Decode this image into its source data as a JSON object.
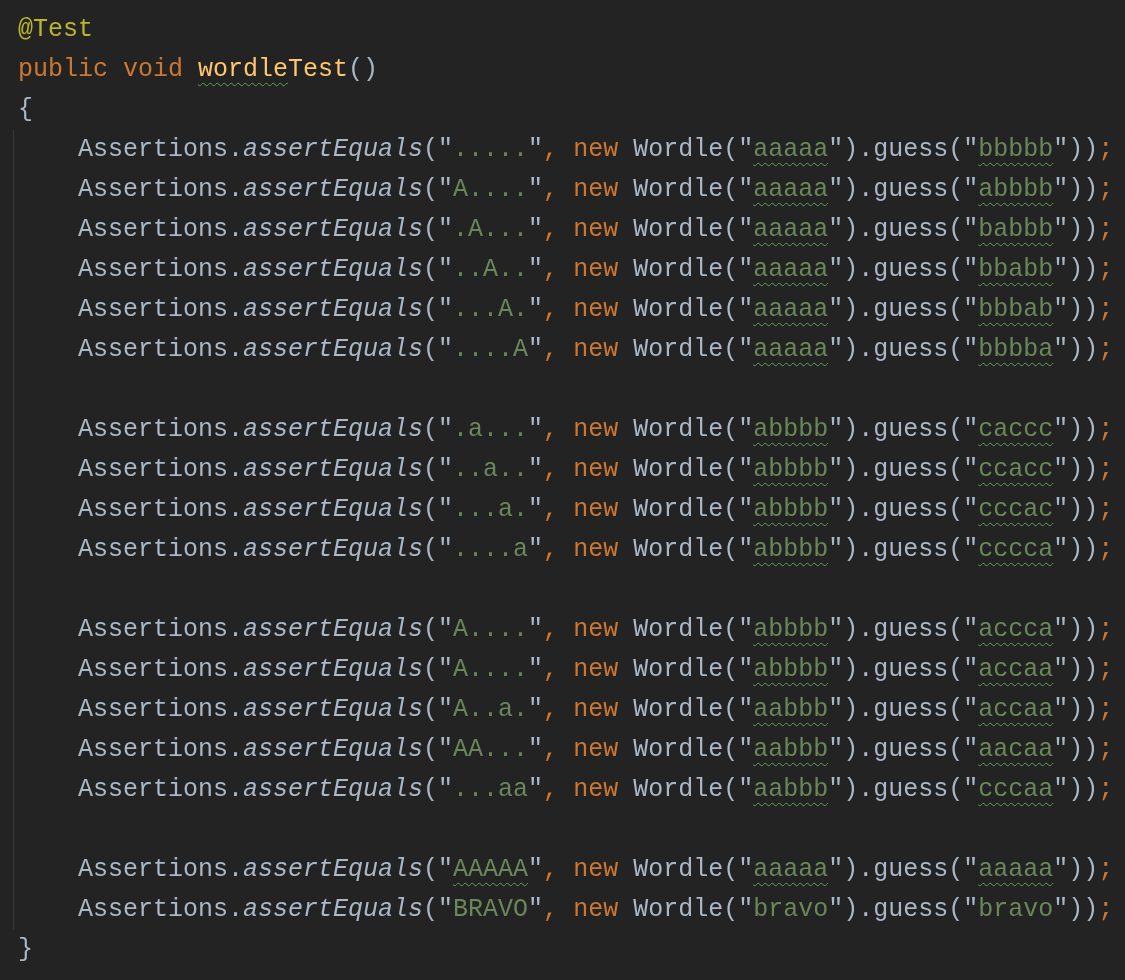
{
  "editor": {
    "lines": [
      {
        "kind": "code",
        "indented": false,
        "tokens": [
          {
            "kind": "annotation",
            "text": "@Test"
          }
        ]
      },
      {
        "kind": "code",
        "indented": false,
        "tokens": [
          {
            "kind": "keyword",
            "text": "public void "
          },
          {
            "kind": "method-decl",
            "text": "wordle",
            "typo": true
          },
          {
            "kind": "method-decl",
            "text": "Test",
            "typo": false
          },
          {
            "kind": "plain",
            "text": "()"
          }
        ]
      },
      {
        "kind": "code",
        "indented": false,
        "tokens": [
          {
            "kind": "plain",
            "text": "{"
          }
        ]
      },
      {
        "kind": "code",
        "indented": true,
        "tokens": [
          {
            "kind": "plain",
            "text": "Assertions."
          },
          {
            "kind": "static-call",
            "text": "assertEquals"
          },
          {
            "kind": "plain",
            "text": "(\""
          },
          {
            "kind": "string",
            "text": ".....",
            "typo": false
          },
          {
            "kind": "plain",
            "text": "\""
          },
          {
            "kind": "separator",
            "text": ", "
          },
          {
            "kind": "keyword",
            "text": "new "
          },
          {
            "kind": "plain",
            "text": "Wordle(\""
          },
          {
            "kind": "string",
            "text": "aaaaa",
            "typo": true
          },
          {
            "kind": "plain",
            "text": "\").guess(\""
          },
          {
            "kind": "string",
            "text": "bbbbb",
            "typo": true
          },
          {
            "kind": "plain",
            "text": "\"))"
          },
          {
            "kind": "separator",
            "text": ";"
          }
        ]
      },
      {
        "kind": "code",
        "indented": true,
        "tokens": [
          {
            "kind": "plain",
            "text": "Assertions."
          },
          {
            "kind": "static-call",
            "text": "assertEquals"
          },
          {
            "kind": "plain",
            "text": "(\""
          },
          {
            "kind": "string",
            "text": "A....",
            "typo": false
          },
          {
            "kind": "plain",
            "text": "\""
          },
          {
            "kind": "separator",
            "text": ", "
          },
          {
            "kind": "keyword",
            "text": "new "
          },
          {
            "kind": "plain",
            "text": "Wordle(\""
          },
          {
            "kind": "string",
            "text": "aaaaa",
            "typo": true
          },
          {
            "kind": "plain",
            "text": "\").guess(\""
          },
          {
            "kind": "string",
            "text": "abbbb",
            "typo": true
          },
          {
            "kind": "plain",
            "text": "\"))"
          },
          {
            "kind": "separator",
            "text": ";"
          }
        ]
      },
      {
        "kind": "code",
        "indented": true,
        "tokens": [
          {
            "kind": "plain",
            "text": "Assertions."
          },
          {
            "kind": "static-call",
            "text": "assertEquals"
          },
          {
            "kind": "plain",
            "text": "(\""
          },
          {
            "kind": "string",
            "text": ".A...",
            "typo": false
          },
          {
            "kind": "plain",
            "text": "\""
          },
          {
            "kind": "separator",
            "text": ", "
          },
          {
            "kind": "keyword",
            "text": "new "
          },
          {
            "kind": "plain",
            "text": "Wordle(\""
          },
          {
            "kind": "string",
            "text": "aaaaa",
            "typo": true
          },
          {
            "kind": "plain",
            "text": "\").guess(\""
          },
          {
            "kind": "string",
            "text": "babbb",
            "typo": true
          },
          {
            "kind": "plain",
            "text": "\"))"
          },
          {
            "kind": "separator",
            "text": ";"
          }
        ]
      },
      {
        "kind": "code",
        "indented": true,
        "tokens": [
          {
            "kind": "plain",
            "text": "Assertions."
          },
          {
            "kind": "static-call",
            "text": "assertEquals"
          },
          {
            "kind": "plain",
            "text": "(\""
          },
          {
            "kind": "string",
            "text": "..A..",
            "typo": false
          },
          {
            "kind": "plain",
            "text": "\""
          },
          {
            "kind": "separator",
            "text": ", "
          },
          {
            "kind": "keyword",
            "text": "new "
          },
          {
            "kind": "plain",
            "text": "Wordle(\""
          },
          {
            "kind": "string",
            "text": "aaaaa",
            "typo": true
          },
          {
            "kind": "plain",
            "text": "\").guess(\""
          },
          {
            "kind": "string",
            "text": "bbabb",
            "typo": true
          },
          {
            "kind": "plain",
            "text": "\"))"
          },
          {
            "kind": "separator",
            "text": ";"
          }
        ]
      },
      {
        "kind": "code",
        "indented": true,
        "tokens": [
          {
            "kind": "plain",
            "text": "Assertions."
          },
          {
            "kind": "static-call",
            "text": "assertEquals"
          },
          {
            "kind": "plain",
            "text": "(\""
          },
          {
            "kind": "string",
            "text": "...A.",
            "typo": false
          },
          {
            "kind": "plain",
            "text": "\""
          },
          {
            "kind": "separator",
            "text": ", "
          },
          {
            "kind": "keyword",
            "text": "new "
          },
          {
            "kind": "plain",
            "text": "Wordle(\""
          },
          {
            "kind": "string",
            "text": "aaaaa",
            "typo": true
          },
          {
            "kind": "plain",
            "text": "\").guess(\""
          },
          {
            "kind": "string",
            "text": "bbbab",
            "typo": true
          },
          {
            "kind": "plain",
            "text": "\"))"
          },
          {
            "kind": "separator",
            "text": ";"
          }
        ]
      },
      {
        "kind": "code",
        "indented": true,
        "tokens": [
          {
            "kind": "plain",
            "text": "Assertions."
          },
          {
            "kind": "static-call",
            "text": "assertEquals"
          },
          {
            "kind": "plain",
            "text": "(\""
          },
          {
            "kind": "string",
            "text": "....A",
            "typo": false
          },
          {
            "kind": "plain",
            "text": "\""
          },
          {
            "kind": "separator",
            "text": ", "
          },
          {
            "kind": "keyword",
            "text": "new "
          },
          {
            "kind": "plain",
            "text": "Wordle(\""
          },
          {
            "kind": "string",
            "text": "aaaaa",
            "typo": true
          },
          {
            "kind": "plain",
            "text": "\").guess(\""
          },
          {
            "kind": "string",
            "text": "bbbba",
            "typo": true
          },
          {
            "kind": "plain",
            "text": "\"))"
          },
          {
            "kind": "separator",
            "text": ";"
          }
        ]
      },
      {
        "kind": "blank",
        "indented": true
      },
      {
        "kind": "code",
        "indented": true,
        "tokens": [
          {
            "kind": "plain",
            "text": "Assertions."
          },
          {
            "kind": "static-call",
            "text": "assertEquals"
          },
          {
            "kind": "plain",
            "text": "(\""
          },
          {
            "kind": "string",
            "text": ".a...",
            "typo": false
          },
          {
            "kind": "plain",
            "text": "\""
          },
          {
            "kind": "separator",
            "text": ", "
          },
          {
            "kind": "keyword",
            "text": "new "
          },
          {
            "kind": "plain",
            "text": "Wordle(\""
          },
          {
            "kind": "string",
            "text": "abbbb",
            "typo": true
          },
          {
            "kind": "plain",
            "text": "\").guess(\""
          },
          {
            "kind": "string",
            "text": "caccc",
            "typo": true
          },
          {
            "kind": "plain",
            "text": "\"))"
          },
          {
            "kind": "separator",
            "text": ";"
          }
        ]
      },
      {
        "kind": "code",
        "indented": true,
        "tokens": [
          {
            "kind": "plain",
            "text": "Assertions."
          },
          {
            "kind": "static-call",
            "text": "assertEquals"
          },
          {
            "kind": "plain",
            "text": "(\""
          },
          {
            "kind": "string",
            "text": "..a..",
            "typo": false
          },
          {
            "kind": "plain",
            "text": "\""
          },
          {
            "kind": "separator",
            "text": ", "
          },
          {
            "kind": "keyword",
            "text": "new "
          },
          {
            "kind": "plain",
            "text": "Wordle(\""
          },
          {
            "kind": "string",
            "text": "abbbb",
            "typo": true
          },
          {
            "kind": "plain",
            "text": "\").guess(\""
          },
          {
            "kind": "string",
            "text": "ccacc",
            "typo": true
          },
          {
            "kind": "plain",
            "text": "\"))"
          },
          {
            "kind": "separator",
            "text": ";"
          }
        ]
      },
      {
        "kind": "code",
        "indented": true,
        "tokens": [
          {
            "kind": "plain",
            "text": "Assertions."
          },
          {
            "kind": "static-call",
            "text": "assertEquals"
          },
          {
            "kind": "plain",
            "text": "(\""
          },
          {
            "kind": "string",
            "text": "...a.",
            "typo": false
          },
          {
            "kind": "plain",
            "text": "\""
          },
          {
            "kind": "separator",
            "text": ", "
          },
          {
            "kind": "keyword",
            "text": "new "
          },
          {
            "kind": "plain",
            "text": "Wordle(\""
          },
          {
            "kind": "string",
            "text": "abbbb",
            "typo": true
          },
          {
            "kind": "plain",
            "text": "\").guess(\""
          },
          {
            "kind": "string",
            "text": "cccac",
            "typo": true
          },
          {
            "kind": "plain",
            "text": "\"))"
          },
          {
            "kind": "separator",
            "text": ";"
          }
        ]
      },
      {
        "kind": "code",
        "indented": true,
        "tokens": [
          {
            "kind": "plain",
            "text": "Assertions."
          },
          {
            "kind": "static-call",
            "text": "assertEquals"
          },
          {
            "kind": "plain",
            "text": "(\""
          },
          {
            "kind": "string",
            "text": "....a",
            "typo": false
          },
          {
            "kind": "plain",
            "text": "\""
          },
          {
            "kind": "separator",
            "text": ", "
          },
          {
            "kind": "keyword",
            "text": "new "
          },
          {
            "kind": "plain",
            "text": "Wordle(\""
          },
          {
            "kind": "string",
            "text": "abbbb",
            "typo": true
          },
          {
            "kind": "plain",
            "text": "\").guess(\""
          },
          {
            "kind": "string",
            "text": "cccca",
            "typo": true
          },
          {
            "kind": "plain",
            "text": "\"))"
          },
          {
            "kind": "separator",
            "text": ";"
          }
        ]
      },
      {
        "kind": "blank",
        "indented": true
      },
      {
        "kind": "code",
        "indented": true,
        "tokens": [
          {
            "kind": "plain",
            "text": "Assertions."
          },
          {
            "kind": "static-call",
            "text": "assertEquals"
          },
          {
            "kind": "plain",
            "text": "(\""
          },
          {
            "kind": "string",
            "text": "A....",
            "typo": false
          },
          {
            "kind": "plain",
            "text": "\""
          },
          {
            "kind": "separator",
            "text": ", "
          },
          {
            "kind": "keyword",
            "text": "new "
          },
          {
            "kind": "plain",
            "text": "Wordle(\""
          },
          {
            "kind": "string",
            "text": "abbbb",
            "typo": true
          },
          {
            "kind": "plain",
            "text": "\").guess(\""
          },
          {
            "kind": "string",
            "text": "accca",
            "typo": true
          },
          {
            "kind": "plain",
            "text": "\"))"
          },
          {
            "kind": "separator",
            "text": ";"
          }
        ]
      },
      {
        "kind": "code",
        "indented": true,
        "tokens": [
          {
            "kind": "plain",
            "text": "Assertions."
          },
          {
            "kind": "static-call",
            "text": "assertEquals"
          },
          {
            "kind": "plain",
            "text": "(\""
          },
          {
            "kind": "string",
            "text": "A....",
            "typo": false
          },
          {
            "kind": "plain",
            "text": "\""
          },
          {
            "kind": "separator",
            "text": ", "
          },
          {
            "kind": "keyword",
            "text": "new "
          },
          {
            "kind": "plain",
            "text": "Wordle(\""
          },
          {
            "kind": "string",
            "text": "abbbb",
            "typo": true
          },
          {
            "kind": "plain",
            "text": "\").guess(\""
          },
          {
            "kind": "string",
            "text": "accaa",
            "typo": true
          },
          {
            "kind": "plain",
            "text": "\"))"
          },
          {
            "kind": "separator",
            "text": ";"
          }
        ]
      },
      {
        "kind": "code",
        "indented": true,
        "tokens": [
          {
            "kind": "plain",
            "text": "Assertions."
          },
          {
            "kind": "static-call",
            "text": "assertEquals"
          },
          {
            "kind": "plain",
            "text": "(\""
          },
          {
            "kind": "string",
            "text": "A..a.",
            "typo": false
          },
          {
            "kind": "plain",
            "text": "\""
          },
          {
            "kind": "separator",
            "text": ", "
          },
          {
            "kind": "keyword",
            "text": "new "
          },
          {
            "kind": "plain",
            "text": "Wordle(\""
          },
          {
            "kind": "string",
            "text": "aabbb",
            "typo": true
          },
          {
            "kind": "plain",
            "text": "\").guess(\""
          },
          {
            "kind": "string",
            "text": "accaa",
            "typo": true
          },
          {
            "kind": "plain",
            "text": "\"))"
          },
          {
            "kind": "separator",
            "text": ";"
          }
        ]
      },
      {
        "kind": "code",
        "indented": true,
        "tokens": [
          {
            "kind": "plain",
            "text": "Assertions."
          },
          {
            "kind": "static-call",
            "text": "assertEquals"
          },
          {
            "kind": "plain",
            "text": "(\""
          },
          {
            "kind": "string",
            "text": "AA...",
            "typo": false
          },
          {
            "kind": "plain",
            "text": "\""
          },
          {
            "kind": "separator",
            "text": ", "
          },
          {
            "kind": "keyword",
            "text": "new "
          },
          {
            "kind": "plain",
            "text": "Wordle(\""
          },
          {
            "kind": "string",
            "text": "aabbb",
            "typo": true
          },
          {
            "kind": "plain",
            "text": "\").guess(\""
          },
          {
            "kind": "string",
            "text": "aacaa",
            "typo": true
          },
          {
            "kind": "plain",
            "text": "\"))"
          },
          {
            "kind": "separator",
            "text": ";"
          }
        ]
      },
      {
        "kind": "code",
        "indented": true,
        "tokens": [
          {
            "kind": "plain",
            "text": "Assertions."
          },
          {
            "kind": "static-call",
            "text": "assertEquals"
          },
          {
            "kind": "plain",
            "text": "(\""
          },
          {
            "kind": "string",
            "text": "...aa",
            "typo": false
          },
          {
            "kind": "plain",
            "text": "\""
          },
          {
            "kind": "separator",
            "text": ", "
          },
          {
            "kind": "keyword",
            "text": "new "
          },
          {
            "kind": "plain",
            "text": "Wordle(\""
          },
          {
            "kind": "string",
            "text": "aabbb",
            "typo": true
          },
          {
            "kind": "plain",
            "text": "\").guess(\""
          },
          {
            "kind": "string",
            "text": "cccaa",
            "typo": true
          },
          {
            "kind": "plain",
            "text": "\"))"
          },
          {
            "kind": "separator",
            "text": ";"
          }
        ]
      },
      {
        "kind": "blank",
        "indented": true
      },
      {
        "kind": "code",
        "indented": true,
        "tokens": [
          {
            "kind": "plain",
            "text": "Assertions."
          },
          {
            "kind": "static-call",
            "text": "assertEquals"
          },
          {
            "kind": "plain",
            "text": "(\""
          },
          {
            "kind": "string",
            "text": "AAAAA",
            "typo": true
          },
          {
            "kind": "plain",
            "text": "\""
          },
          {
            "kind": "separator",
            "text": ", "
          },
          {
            "kind": "keyword",
            "text": "new "
          },
          {
            "kind": "plain",
            "text": "Wordle(\""
          },
          {
            "kind": "string",
            "text": "aaaaa",
            "typo": true
          },
          {
            "kind": "plain",
            "text": "\").guess(\""
          },
          {
            "kind": "string",
            "text": "aaaaa",
            "typo": true
          },
          {
            "kind": "plain",
            "text": "\"))"
          },
          {
            "kind": "separator",
            "text": ";"
          }
        ]
      },
      {
        "kind": "code",
        "indented": true,
        "tokens": [
          {
            "kind": "plain",
            "text": "Assertions."
          },
          {
            "kind": "static-call",
            "text": "assertEquals"
          },
          {
            "kind": "plain",
            "text": "(\""
          },
          {
            "kind": "string",
            "text": "BRAVO",
            "typo": false
          },
          {
            "kind": "plain",
            "text": "\""
          },
          {
            "kind": "separator",
            "text": ", "
          },
          {
            "kind": "keyword",
            "text": "new "
          },
          {
            "kind": "plain",
            "text": "Wordle(\""
          },
          {
            "kind": "string",
            "text": "bravo",
            "typo": false
          },
          {
            "kind": "plain",
            "text": "\").guess(\""
          },
          {
            "kind": "string",
            "text": "bravo",
            "typo": false
          },
          {
            "kind": "plain",
            "text": "\"))"
          },
          {
            "kind": "separator",
            "text": ";"
          }
        ]
      },
      {
        "kind": "code",
        "indented": false,
        "tokens": [
          {
            "kind": "plain",
            "text": "}"
          }
        ]
      }
    ]
  }
}
